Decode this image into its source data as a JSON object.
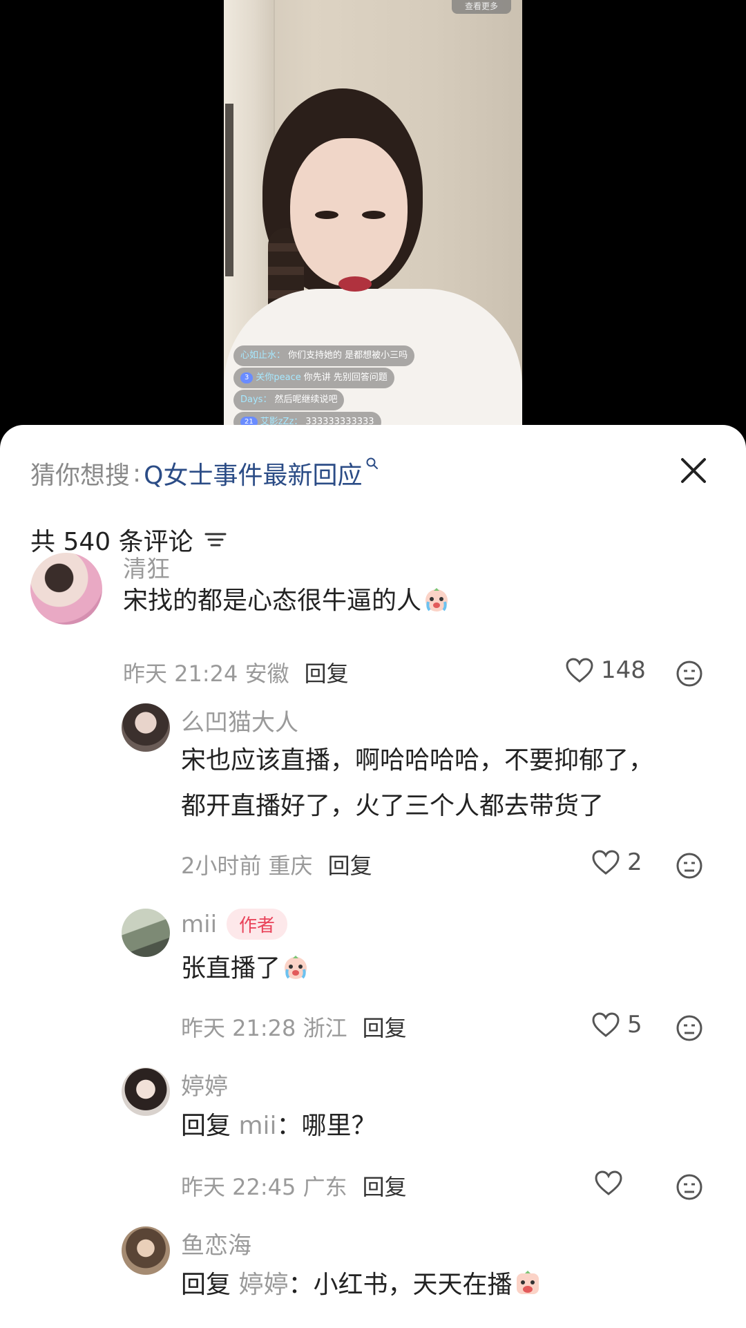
{
  "video": {
    "top_pill": "查看更多",
    "danmu": [
      {
        "user": "心如止水：",
        "level": "",
        "text": "你们支持她的 是都想被小三吗"
      },
      {
        "user": "关你peace",
        "level": "3",
        "text": "你先讲 先别回答问题"
      },
      {
        "user": "Days：",
        "level": "",
        "text": "然后呢继续说吧"
      },
      {
        "user": "艾影zZz：",
        "level": "21",
        "text": "333333333333"
      }
    ]
  },
  "search": {
    "prefix": "猜你想搜",
    "separator": ":",
    "term": "Q女士事件最新回应"
  },
  "comment_count": "共 540 条评论",
  "comments": [
    {
      "user": "清狂",
      "text": "宋找的都是心态很牛逼的人",
      "time": "昨天 21:24",
      "location": "安徽",
      "reply": "回复",
      "likes": "148"
    },
    {
      "user": "么凹猫大人",
      "text_line1": "宋也应该直播，啊哈哈哈哈，不要抑郁了，",
      "text_line2": "都开直播好了，火了三个人都去带货了",
      "time": "2小时前",
      "location": "重庆",
      "reply": "回复",
      "likes": "2"
    },
    {
      "user": "mii",
      "badge": "作者",
      "text": "张直播了",
      "time": "昨天 21:28",
      "location": "浙江",
      "reply": "回复",
      "likes": "5"
    },
    {
      "user": "婷婷",
      "reply_prefix": "回复",
      "reply_to": "mii",
      "text": "：哪里？",
      "time": "昨天 22:45",
      "location": "广东",
      "reply": "回复",
      "likes": ""
    },
    {
      "user": "鱼恋海",
      "reply_prefix": "回复",
      "reply_to": "婷婷",
      "text": "：小红书，天天在播"
    }
  ],
  "colors": {
    "link": "#2b4c86",
    "badge_bg": "#fde8ea",
    "badge_text": "#e9435a",
    "muted": "#9a9a9a"
  }
}
